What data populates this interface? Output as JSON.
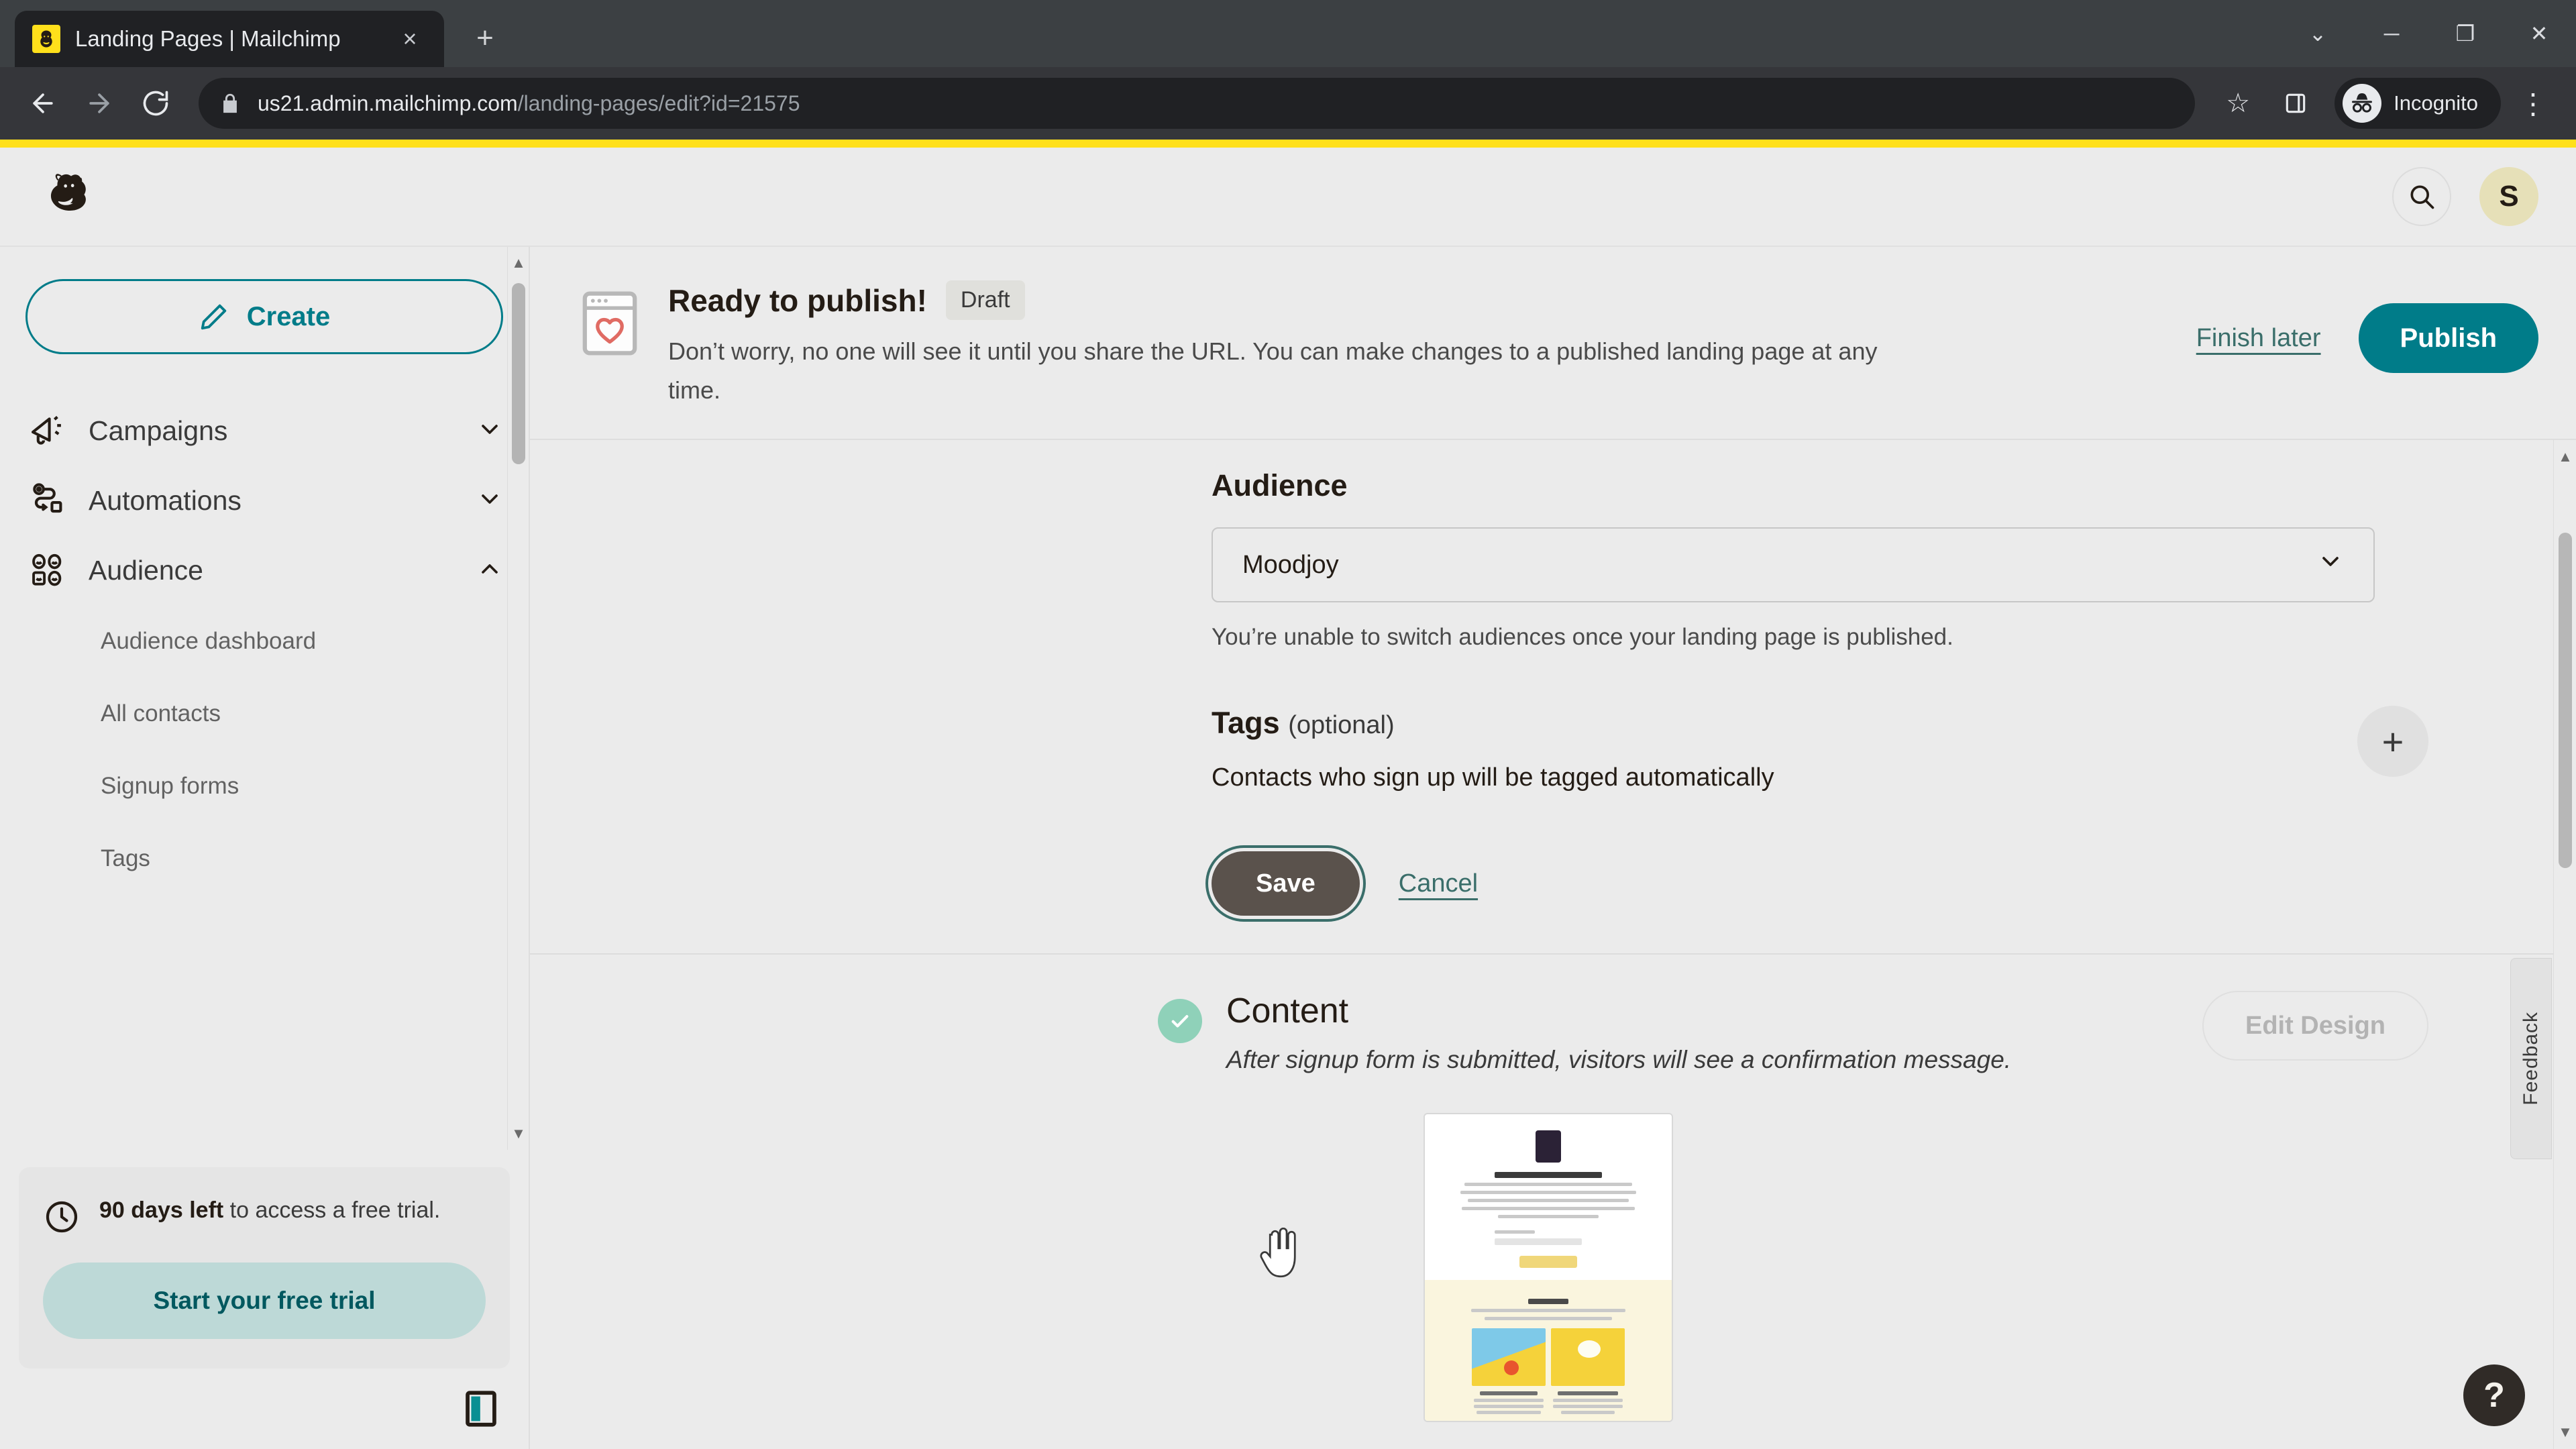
{
  "browser": {
    "tab": {
      "title": "Landing Pages | Mailchimp",
      "favicon": "mailchimp-favicon",
      "close": "×"
    },
    "new_tab": "+",
    "window_controls": {
      "minimize_all": "⌄",
      "minimize": "─",
      "maximize": "❐",
      "close": "✕"
    },
    "nav": {
      "back": "←",
      "forward": "→",
      "reload": "↻"
    },
    "omnibox": {
      "lock": "lock-icon",
      "url_host": "us21.admin.mailchimp.com",
      "url_path": "/landing-pages/edit?id=21575"
    },
    "bookmark": "☆",
    "side_panel": "side-panel-icon",
    "profile": {
      "label": "Incognito",
      "icon": "incognito-icon"
    },
    "menu": "⋮"
  },
  "header": {
    "logo": "mailchimp-freddie-logo",
    "search": "search-icon",
    "avatar_initial": "S"
  },
  "sidebar": {
    "create_label": "Create",
    "create_icon": "pencil-icon",
    "nav": [
      {
        "label": "Campaigns",
        "icon": "megaphone-icon",
        "chevron": "⌄",
        "expanded": false
      },
      {
        "label": "Automations",
        "icon": "automation-path-icon",
        "chevron": "⌄",
        "expanded": false
      },
      {
        "label": "Audience",
        "icon": "audience-people-icon",
        "chevron": "⌃",
        "expanded": true
      }
    ],
    "audience_subnav": [
      "Audience dashboard",
      "All contacts",
      "Signup forms",
      "Tags"
    ],
    "trial": {
      "icon": "clock-icon",
      "days_bold": "90 days left",
      "text_rest": " to access a free trial.",
      "button_label": "Start your free trial"
    },
    "panel_toggle": "panel-toggle-icon",
    "scroll_up": "▲",
    "scroll_down": "▼"
  },
  "banner": {
    "icon": "browser-heart-icon",
    "title": "Ready to publish!",
    "badge": "Draft",
    "description": "Don’t worry, no one will see it until you share the URL. You can make changes to a published landing page at any time.",
    "finish_later": "Finish later",
    "publish": "Publish"
  },
  "audience_section": {
    "heading": "Audience",
    "select_value": "Moodjoy",
    "select_chevron": "⌄",
    "help_text": "You’re unable to switch audiences once your landing page is published.",
    "tags_label": "Tags",
    "tags_optional": "(optional)",
    "add_tag_icon": "+",
    "tags_description": "Contacts who sign up will be tagged automatically",
    "save_label": "Save",
    "cancel_label": "Cancel"
  },
  "content_section": {
    "status_icon": "check-icon",
    "title": "Content",
    "subtitle": "After signup form is submitted, visitors will see a confirmation message.",
    "edit_design_label": "Edit Design",
    "preview": "landing-page-thumbnail"
  },
  "feedback_tab": "Feedback",
  "help_button": "?",
  "colors": {
    "brand_yellow": "#ffe01b",
    "teal": "#007c89",
    "teal_link": "#3a6e6a",
    "save_dark": "#5a524c",
    "success_green": "#8fd1b9",
    "page_bg": "#ebebeb"
  }
}
